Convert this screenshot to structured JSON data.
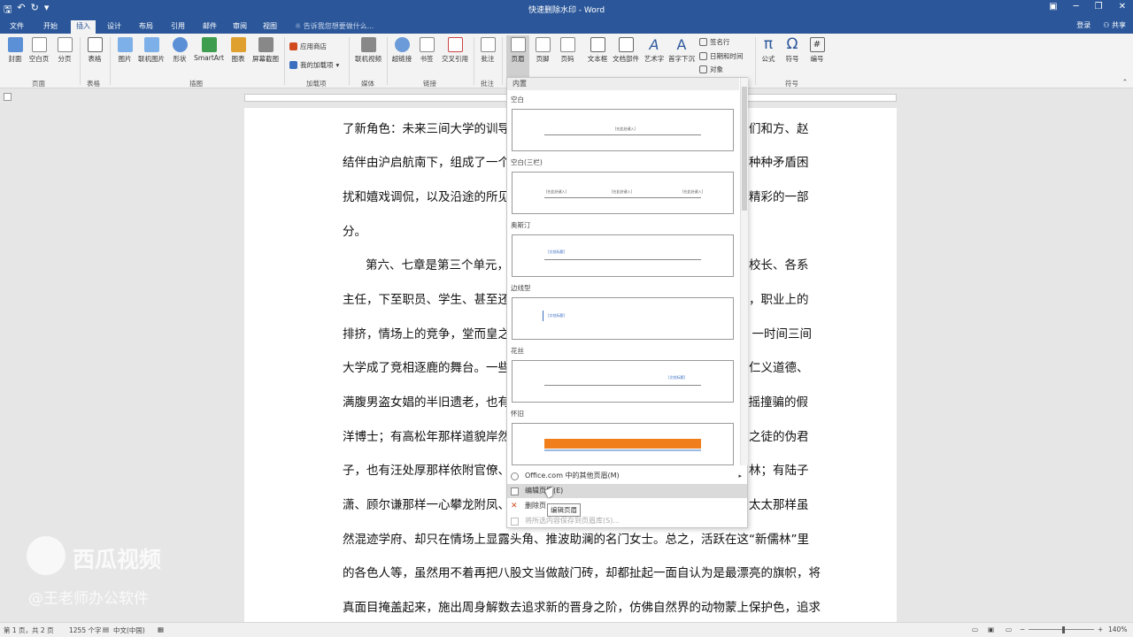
{
  "window": {
    "title": "快速删除水印 - Word"
  },
  "tabs": [
    "文件",
    "开始",
    "插入",
    "设计",
    "布局",
    "引用",
    "邮件",
    "审阅",
    "视图"
  ],
  "active_tab": "插入",
  "tell_me": "告诉我您想要做什么...",
  "user": {
    "login": "登录",
    "share": "共享"
  },
  "ribbon": {
    "buttons": {
      "cover": "封面",
      "blank_page": "空白页",
      "page_break": "分页",
      "table": "表格",
      "picture": "图片",
      "online_picture": "联机图片",
      "shapes": "形状",
      "smartart": "SmartArt",
      "chart": "图表",
      "screenshot": "屏幕截图",
      "app_store": "应用商店",
      "my_addins": "我的加载项",
      "online_video": "联机视频",
      "hyperlink": "超链接",
      "bookmark": "书签",
      "cross_ref": "交叉引用",
      "comment": "批注",
      "header": "页眉",
      "footer": "页脚",
      "page_number": "页码",
      "textbox": "文本框",
      "quick_parts": "文档部件",
      "wordart": "艺术字",
      "dropcap": "首字下沉",
      "signature": "签名行",
      "datetime": "日期和时间",
      "object": "对象",
      "equation": "公式",
      "symbol": "符号",
      "number": "编号"
    },
    "groups": {
      "pages": "页面",
      "tables": "表格",
      "illustrations": "插图",
      "addins": "加载项",
      "media": "媒体",
      "links": "链接",
      "comments": "批注",
      "symbols": "符号"
    }
  },
  "document": {
    "lines": [
      "了新角色：未来三间大学的训导",
      "结伴由沪启航南下，组成了一个",
      "扰和嬉戏调侃，以及沿途的所见",
      "分。",
      "第六、七章是第三个单元，",
      "主任，下至职员、学生、甚至还",
      "排挤，情场上的竞争，堂而皇之",
      "大学成了竞相逐鹿的舞台。一些",
      "满腹男盗女娼的半旧遗老，也有",
      "洋博士；有高松年那样道貌岸然",
      "子，也有汪处厚那样依附官僚、",
      "潇、顾尔谦那样一心攀龙附凤、",
      "然混迹学府、却只在情场上显露头角、推波助澜的名门女士。总之，活跃在这“新儒林”里",
      "的各色人等，虽然用不着再把八股文当做敲门砖，却都扯起一面自认为是最漂亮的旗帜，将",
      "真面目掩盖起来，施出周身解数去追求新的晋身之阶，仿佛自然界的动物蒙上保护色，追求"
    ],
    "right_fragments": [
      "们和方、赵",
      "种种矛盾困",
      "精彩的一部",
      "",
      "校长、各系",
      "，职业上的",
      "，一时间三间",
      "仁义道德、",
      "招摇撞骗的假",
      "之徒的伪君",
      "林；有陆子",
      "太太那样虽"
    ]
  },
  "dropdown": {
    "header": "内置",
    "gallery": [
      {
        "name": "空白",
        "placeholders": [
          "[在此处键入]"
        ]
      },
      {
        "name": "空白(三栏)",
        "placeholders": [
          "[在此处键入]",
          "[在此处键入]",
          "[在此处键入]"
        ]
      },
      {
        "name": "奥斯汀",
        "placeholders": [
          "[文档标题]"
        ]
      },
      {
        "name": "边线型",
        "placeholders": [
          "[文档标题]"
        ]
      },
      {
        "name": "花丝",
        "placeholders": [
          "[文档标题]"
        ]
      },
      {
        "name": "怀旧",
        "placeholders": []
      }
    ],
    "menu": {
      "more": "Office.com 中的其他页眉(M)",
      "edit": "编辑页眉(E)",
      "remove": "删除页",
      "save": "将所选内容保存到页眉库(S)..."
    },
    "tooltip": "编辑页眉"
  },
  "watermark": {
    "logo_text": "西瓜视频",
    "author": "@王老师办公软件"
  },
  "status": {
    "page": "第 1 页，共 2 页",
    "words": "1255 个字",
    "language": "中文(中国)",
    "zoom": "140%"
  }
}
